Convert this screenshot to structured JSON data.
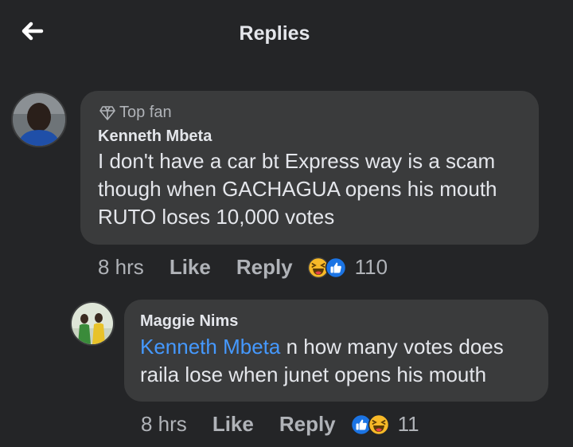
{
  "header": {
    "title": "Replies",
    "back_icon": "arrow-left-icon"
  },
  "comments": [
    {
      "badge": "Top fan",
      "badge_icon": "diamond-icon",
      "author": "Kenneth Mbeta",
      "text_lines": [
        "I don't have a car bt Express way is a scam",
        "though when GACHAGUA opens his mouth",
        "RUTO loses 10,000 votes"
      ],
      "time": "8 hrs",
      "like_label": "Like",
      "reply_label": "Reply",
      "reactions": [
        "haha-icon",
        "like-icon"
      ],
      "reaction_count": "110"
    },
    {
      "author": "Maggie Nims",
      "mention": "Kenneth Mbeta",
      "text_line1_rest": " n how many votes does",
      "text_line2": "raila lose when junet opens his mouth",
      "time": "8 hrs",
      "like_label": "Like",
      "reply_label": "Reply",
      "reactions": [
        "like-icon",
        "haha-icon"
      ],
      "reaction_count": "11"
    }
  ],
  "colors": {
    "background": "#242527",
    "bubble": "#3a3b3c",
    "primary_text": "#e4e6eb",
    "secondary_text": "#b0b3b8",
    "mention": "#4599ff",
    "like_blue": "#1b74e4",
    "haha_yellow": "#f7b928"
  }
}
